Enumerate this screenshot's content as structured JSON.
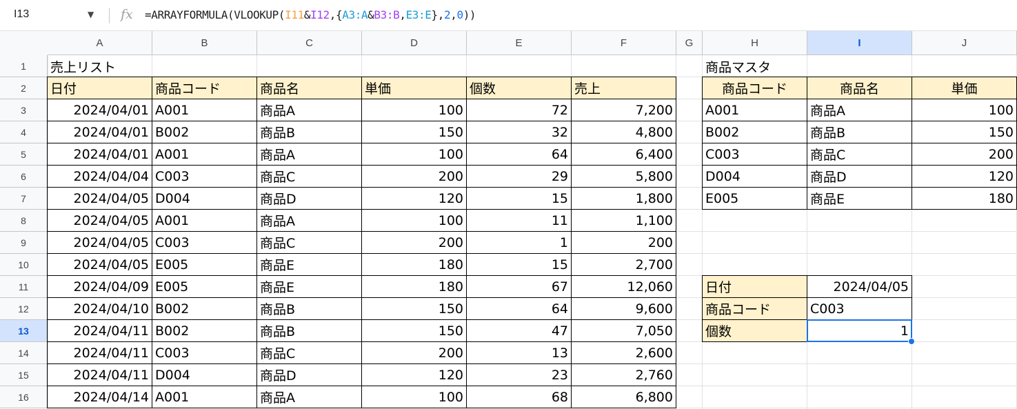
{
  "formula_bar": {
    "cell_ref": "I13",
    "fx_symbol": "fx",
    "formula_parts": [
      {
        "t": "=ARRAYFORMULA(VLOOKUP(",
        "c": ""
      },
      {
        "t": "I11",
        "c": "f-ref1"
      },
      {
        "t": "&",
        "c": ""
      },
      {
        "t": "I12",
        "c": "f-ref2"
      },
      {
        "t": ",{",
        "c": ""
      },
      {
        "t": "A3:A",
        "c": "f-ref3"
      },
      {
        "t": "&",
        "c": ""
      },
      {
        "t": "B3:B",
        "c": "f-ref2"
      },
      {
        "t": ",",
        "c": ""
      },
      {
        "t": "E3:E",
        "c": "f-ref3"
      },
      {
        "t": "},",
        "c": ""
      },
      {
        "t": "2",
        "c": "f-num"
      },
      {
        "t": ",",
        "c": ""
      },
      {
        "t": "0",
        "c": "f-num"
      },
      {
        "t": "))",
        "c": ""
      }
    ]
  },
  "columns": [
    "A",
    "B",
    "C",
    "D",
    "E",
    "F",
    "G",
    "H",
    "I",
    "J"
  ],
  "selected_column": "I",
  "rows": [
    "1",
    "2",
    "3",
    "4",
    "5",
    "6",
    "7",
    "8",
    "9",
    "10",
    "11",
    "12",
    "13",
    "14",
    "15",
    "16"
  ],
  "selected_row": "13",
  "sales": {
    "title": "売上リスト",
    "headers": [
      "日付",
      "商品コード",
      "商品名",
      "単価",
      "個数",
      "売上"
    ],
    "rows": [
      [
        "2024/04/01",
        "A001",
        "商品A",
        "100",
        "72",
        "7,200"
      ],
      [
        "2024/04/01",
        "B002",
        "商品B",
        "150",
        "32",
        "4,800"
      ],
      [
        "2024/04/01",
        "A001",
        "商品A",
        "100",
        "64",
        "6,400"
      ],
      [
        "2024/04/04",
        "C003",
        "商品C",
        "200",
        "29",
        "5,800"
      ],
      [
        "2024/04/05",
        "D004",
        "商品D",
        "120",
        "15",
        "1,800"
      ],
      [
        "2024/04/05",
        "A001",
        "商品A",
        "100",
        "11",
        "1,100"
      ],
      [
        "2024/04/05",
        "C003",
        "商品C",
        "200",
        "1",
        "200"
      ],
      [
        "2024/04/05",
        "E005",
        "商品E",
        "180",
        "15",
        "2,700"
      ],
      [
        "2024/04/09",
        "E005",
        "商品E",
        "180",
        "67",
        "12,060"
      ],
      [
        "2024/04/10",
        "B002",
        "商品B",
        "150",
        "64",
        "9,600"
      ],
      [
        "2024/04/11",
        "B002",
        "商品B",
        "150",
        "47",
        "7,050"
      ],
      [
        "2024/04/11",
        "C003",
        "商品C",
        "200",
        "13",
        "2,600"
      ],
      [
        "2024/04/11",
        "D004",
        "商品D",
        "120",
        "23",
        "2,760"
      ],
      [
        "2024/04/14",
        "A001",
        "商品A",
        "100",
        "68",
        "6,800"
      ]
    ]
  },
  "master": {
    "title": "商品マスタ",
    "headers": [
      "商品コード",
      "商品名",
      "単価"
    ],
    "rows": [
      [
        "A001",
        "商品A",
        "100"
      ],
      [
        "B002",
        "商品B",
        "150"
      ],
      [
        "C003",
        "商品C",
        "200"
      ],
      [
        "D004",
        "商品D",
        "120"
      ],
      [
        "E005",
        "商品E",
        "180"
      ]
    ]
  },
  "lookup": {
    "rows": [
      {
        "label": "日付",
        "value": "2024/04/05"
      },
      {
        "label": "商品コード",
        "value": "C003"
      },
      {
        "label": "個数",
        "value": "1"
      }
    ]
  },
  "colors": {
    "header_fill": "#fff2cc",
    "selection": "#1a73e8",
    "selected_header": "#d3e3fd"
  }
}
